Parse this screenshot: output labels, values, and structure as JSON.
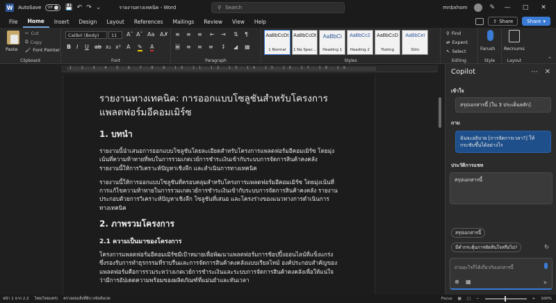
{
  "titlebar": {
    "autosave_label": "AutoSave",
    "autosave_state": "Off",
    "doc_title": "รายงานทางเทคนิค - Word",
    "search_placeholder": "Search",
    "user_name": "mnbxhom"
  },
  "menu": {
    "tabs": [
      "File",
      "Home",
      "Insert",
      "Design",
      "Layout",
      "References",
      "Mailings",
      "Review",
      "View",
      "Help"
    ],
    "active_tab": "Home",
    "share_label": "Share",
    "share2_label": "Share"
  },
  "ribbon": {
    "clipboard": {
      "paste": "Paste",
      "cut": "Cut",
      "copy": "Copy",
      "format_painter": "Font Painter",
      "label": "Clipboard"
    },
    "font": {
      "family": "Calibri (Body)",
      "size": "11",
      "label": "Font"
    },
    "paragraph": {
      "label": "Paragraph"
    },
    "styles": {
      "label": "Styles",
      "items": [
        {
          "sample": "AaBbCcDt",
          "name": "1 Normal"
        },
        {
          "sample": "AaBbCcDt",
          "name": "1 Na Spec..."
        },
        {
          "sample": "AaBbCi",
          "name": "Heading 1"
        },
        {
          "sample": "AaBbCc2",
          "name": "Heading 2"
        },
        {
          "sample": "AaBbCcD",
          "name": "Trating"
        },
        {
          "sample": "AaBbCel",
          "name": "Slim"
        }
      ]
    },
    "editing": {
      "find": "Find",
      "replace": "Expent",
      "select": "Select",
      "label": "Editing"
    },
    "voice": {
      "dictate": "Farush",
      "label": "Style"
    },
    "reuse": {
      "label_top": "Recnums",
      "label": "Layout"
    }
  },
  "document": {
    "title": "รายงานทางเทคนิค: การออกแบบโซลูชันสำหรับโครงการแพลตฟอร์มอีคอมเมิร์ซ",
    "h1_intro": "1. บทนำ",
    "p1": "รายงานนี้นำเสนอการออกแบบโซลูชันโดยละเอียดสำหรับโครงการแพลตฟอร์มอีคอมเมิร์ซ โดยมุ่งเน้นที่ความท้าทายที่พบในการรวมเกตเวย์การชำระเงินเข้ากับระบบการจัดการสินค้าคงคลัง รายงานนี้ให้การวิเคราะห์ปัญหาเชิงลึก และสำเนินการทางเทคนิค",
    "p2": "รายงานนี้ให้การออกแบบโซลูชันที่ครอบคลุมสำหรับโครงการแพลตฟอร์มอีคอมเมิร์ซ โดยมุ่งเน้นที่การแก้ไขความท้าทายในการรวมเกตเวย์การชำระเงินเข้ากับระบบการจัดการสินค้าคงคลัง รายงานประกอบด้วยการวิเคราะห์ปัญหาเชิงลึก โซลูชันที่เสนอ และโครงร่างของแนวทางการดำเนินการทางเทคนิค",
    "h1_overview": "2. ภาพรวมโครงการ",
    "h2_background": "2.1 ความเป็นมาของโครงการ",
    "p3": "โครงการแพลตฟอร์มอีคอมเมิร์ซมีเป้าหมายเพื่อพัฒนาแพลตฟอร์มการช้อปปิ้งออนไลน์ที่แข็งแกร่งซึ่งรองรับการทำธุรกรรมที่ราบรื่นและการจัดการสินค้าคงคลังแบบเรียลไทม์ องค์ประกอบสำคัญของแพลตฟอร์มคือการรวมระหว่างเกตเวย์การชำระเงินและระบบการจัดการสินค้าคงคลังเพื่อให้แน่ใจว่ามีการอัปเดตความพร้อมของผลิตภัณฑ์ที่แม่นยำและทันเวลา"
  },
  "copilot": {
    "title": "Copilot",
    "section_understand": "เข้าใจ",
    "understand_card": "สรุปเอกสารนี้ [ใน 3 ประเด็นหลัก]",
    "section_ask": "ถาม",
    "ask_card": "ฉันจะอธิบาย [การจัดการเวลา?] ให้กระชับขึ้นได้อย่างไร",
    "section_history": "ประวัติการแชท",
    "history_card": "สรุปเอกสารนี้",
    "chip1": "สรุปเอกสารนี้",
    "chip2": "มีคำกระตุ้นการตัดสินใจหรือไม่?",
    "input_placeholder": "ถามอะไรก็ได้เกี่ยวกับเอกสารนี้"
  },
  "statusbar": {
    "page": "หน้า 1 จาก 2.2",
    "lang": "ไทย(ไทยแทร่)",
    "accessibility": "ตรวจสอบสิ่งที่มีบางข้อสังเกต",
    "focus": "Focus",
    "zoom": "100%"
  },
  "colors": {
    "accent": "#3a7bd5",
    "ribbon_bg": "#292929",
    "page_bg": "#1c1c1c"
  }
}
